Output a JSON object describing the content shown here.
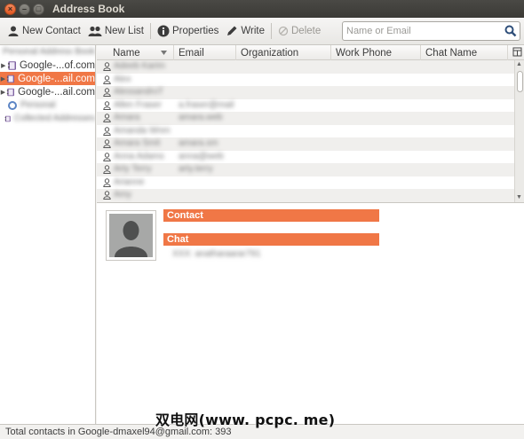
{
  "window": {
    "title": "Address Book"
  },
  "toolbar": {
    "new_contact": "New Contact",
    "new_list": "New List",
    "properties": "Properties",
    "write": "Write",
    "delete": "Delete"
  },
  "search": {
    "placeholder": "Name or Email",
    "value": ""
  },
  "address_books": [
    {
      "label": "Personal Address Book",
      "selected": false,
      "expandable": false
    },
    {
      "label": "Google-...of.com",
      "selected": false,
      "expandable": true
    },
    {
      "label": "Google-...ail.com",
      "selected": true,
      "expandable": true
    },
    {
      "label": "Google-...ail.com",
      "selected": false,
      "expandable": true
    },
    {
      "label": "Personal",
      "selected": false,
      "expandable": false
    },
    {
      "label": "Collected Addresses",
      "selected": false,
      "expandable": false
    }
  ],
  "table": {
    "columns": [
      "Name",
      "Email",
      "Organization",
      "Work Phone",
      "Chat Name"
    ],
    "rows": [
      {
        "name": "Adeeb Karim",
        "email": ""
      },
      {
        "name": "Alex",
        "email": ""
      },
      {
        "name": "AlessandroT",
        "email": ""
      },
      {
        "name": "Allen Fraser",
        "email": "a.fraser@mail"
      },
      {
        "name": "Amara",
        "email": "amara.web"
      },
      {
        "name": "Amanda Wren",
        "email": ""
      },
      {
        "name": "Amara Smit",
        "email": "amara.sm"
      },
      {
        "name": "Anna Adams",
        "email": "anna@web"
      },
      {
        "name": "Arty Terry",
        "email": "arty.terry"
      },
      {
        "name": "Arianne",
        "email": ""
      },
      {
        "name": "Amy",
        "email": ""
      }
    ]
  },
  "detail": {
    "contact_heading": "Contact",
    "chat_heading": "Chat",
    "chat_value": "XXX: anatharaarar791"
  },
  "status": {
    "text": "Total contacts in Google-dmaxel94@gmail.com: 393"
  },
  "watermark": {
    "text": "双电网(www. pcpc. me)"
  },
  "colors": {
    "accent": "#f07746",
    "titlebar": "#3b3a36"
  }
}
